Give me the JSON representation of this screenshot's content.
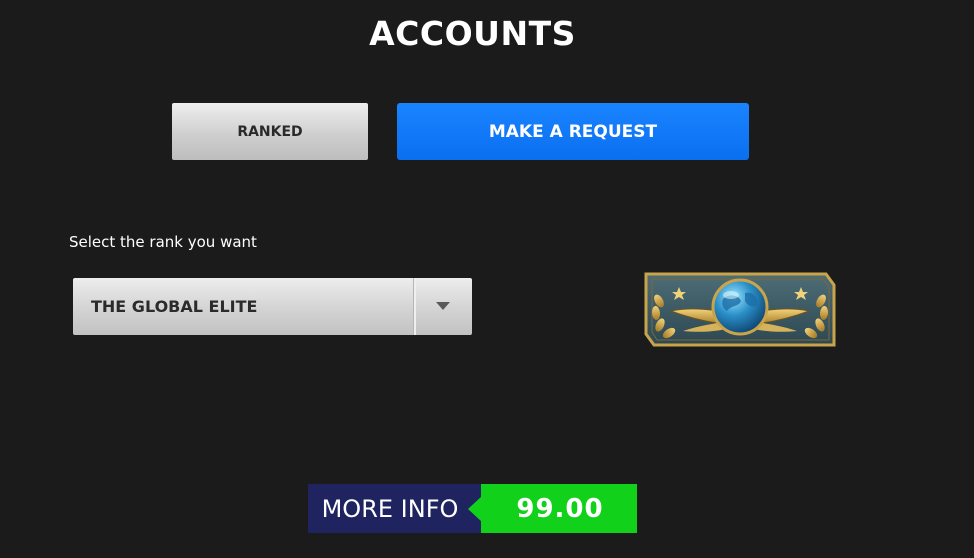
{
  "page": {
    "title": "ACCOUNTS"
  },
  "tabs": {
    "ranked_label": "RANKED",
    "request_label": "MAKE A REQUEST"
  },
  "rank_selector": {
    "label": "Select the rank you want",
    "selected_value": "THE GLOBAL ELITE",
    "badge_icon": "global-elite-badge-icon"
  },
  "footer": {
    "more_info_label": "MORE INFO",
    "price": "99.00"
  },
  "colors": {
    "background": "#1b1b1c",
    "request_button": "#0a6ff0",
    "more_info_bg": "#1f2460",
    "price_bg": "#12d11a"
  }
}
